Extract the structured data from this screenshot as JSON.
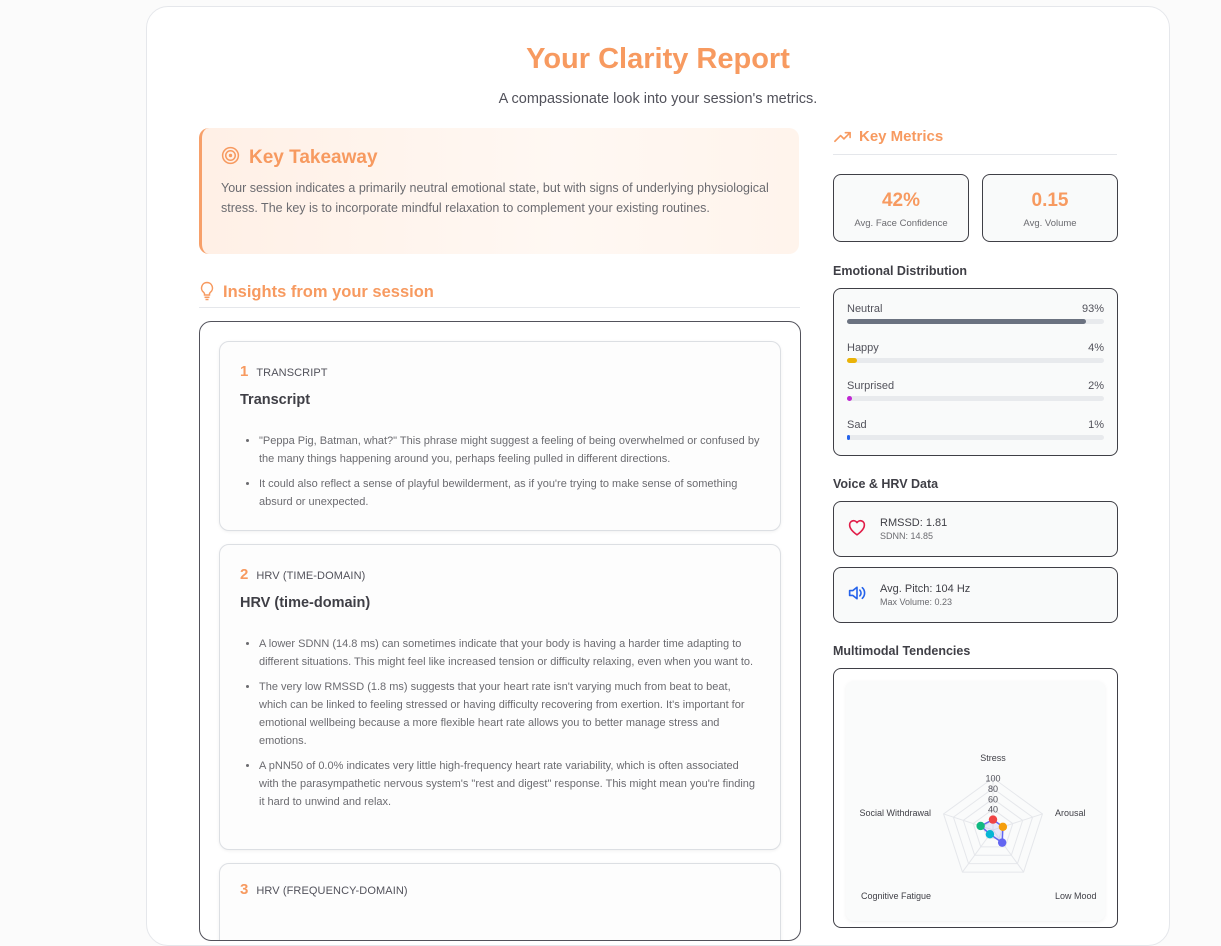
{
  "header": {
    "title": "Your Clarity Report",
    "subtitle": "A compassionate look into your session's metrics."
  },
  "takeaway": {
    "title": "Key Takeaway",
    "text": "Your session indicates a primarily neutral emotional state, but with signs of underlying physiological stress. The key is to incorporate mindful relaxation to complement your existing routines."
  },
  "insights": {
    "title": "Insights from your session",
    "cards": [
      {
        "num": "1",
        "tag": "TRANSCRIPT",
        "title": "Transcript",
        "bullets": [
          "\"Peppa Pig, Batman, what?\" This phrase might suggest a feeling of being overwhelmed or confused by the many things happening around you, perhaps feeling pulled in different directions.",
          "It could also reflect a sense of playful bewilderment, as if you're trying to make sense of something absurd or unexpected."
        ]
      },
      {
        "num": "2",
        "tag": "HRV (TIME-DOMAIN)",
        "title": "HRV (time-domain)",
        "bullets": [
          "A lower SDNN (14.8 ms) can sometimes indicate that your body is having a harder time adapting to different situations. This might feel like increased tension or difficulty relaxing, even when you want to.",
          "The very low RMSSD (1.8 ms) suggests that your heart rate isn't varying much from beat to beat, which can be linked to feeling stressed or having difficulty recovering from exertion. It's important for emotional wellbeing because a more flexible heart rate allows you to better manage stress and emotions.",
          "A pNN50 of 0.0% indicates very little high-frequency heart rate variability, which is often associated with the parasympathetic nervous system's \"rest and digest\" response. This might mean you're finding it hard to unwind and relax."
        ]
      },
      {
        "num": "3",
        "tag": "HRV (FREQUENCY-DOMAIN)",
        "title": "",
        "bullets": []
      }
    ]
  },
  "key_metrics": {
    "title": "Key Metrics",
    "cards": [
      {
        "value": "42%",
        "label": "Avg. Face Confidence"
      },
      {
        "value": "0.15",
        "label": "Avg. Volume"
      }
    ]
  },
  "emotional_distribution": {
    "title": "Emotional Distribution",
    "rows": [
      {
        "name": "Neutral",
        "pct_text": "93%",
        "value": 93,
        "color": "#6b7280"
      },
      {
        "name": "Happy",
        "pct_text": "4%",
        "value": 4,
        "color": "#eab308"
      },
      {
        "name": "Surprised",
        "pct_text": "2%",
        "value": 2,
        "color": "#c026d3"
      },
      {
        "name": "Sad",
        "pct_text": "1%",
        "value": 1,
        "color": "#2563eb"
      }
    ]
  },
  "voice_hrv": {
    "title": "Voice & HRV Data",
    "hrv": {
      "icon": "heart-icon",
      "main": "RMSSD: 1.81",
      "sub": "SDNN: 14.85",
      "color": "#e11d48"
    },
    "voice": {
      "icon": "speaker-icon",
      "main": "Avg. Pitch: 104 Hz",
      "sub": "Max Volume: 0.23",
      "color": "#2563eb"
    }
  },
  "multimodal": {
    "title": "Multimodal Tendencies",
    "chart_data": {
      "type": "radar",
      "axes": [
        "Stress",
        "Arousal",
        "Low Mood",
        "Cognitive Fatigue",
        "Social Withdrawal"
      ],
      "tick_labels": [
        "100",
        "80",
        "60",
        "40"
      ],
      "rmax": 100,
      "points": [
        {
          "axis": "Stress",
          "value": 20,
          "color": "#ef4444"
        },
        {
          "axis": "Arousal",
          "value": 20,
          "color": "#f59e0b"
        },
        {
          "axis": "Low Mood",
          "value": 30,
          "color": "#6366f1"
        },
        {
          "axis": "Cognitive Fatigue",
          "value": 10,
          "color": "#06b6d4"
        },
        {
          "axis": "Social Withdrawal",
          "value": 25,
          "color": "#10b981"
        }
      ]
    }
  }
}
